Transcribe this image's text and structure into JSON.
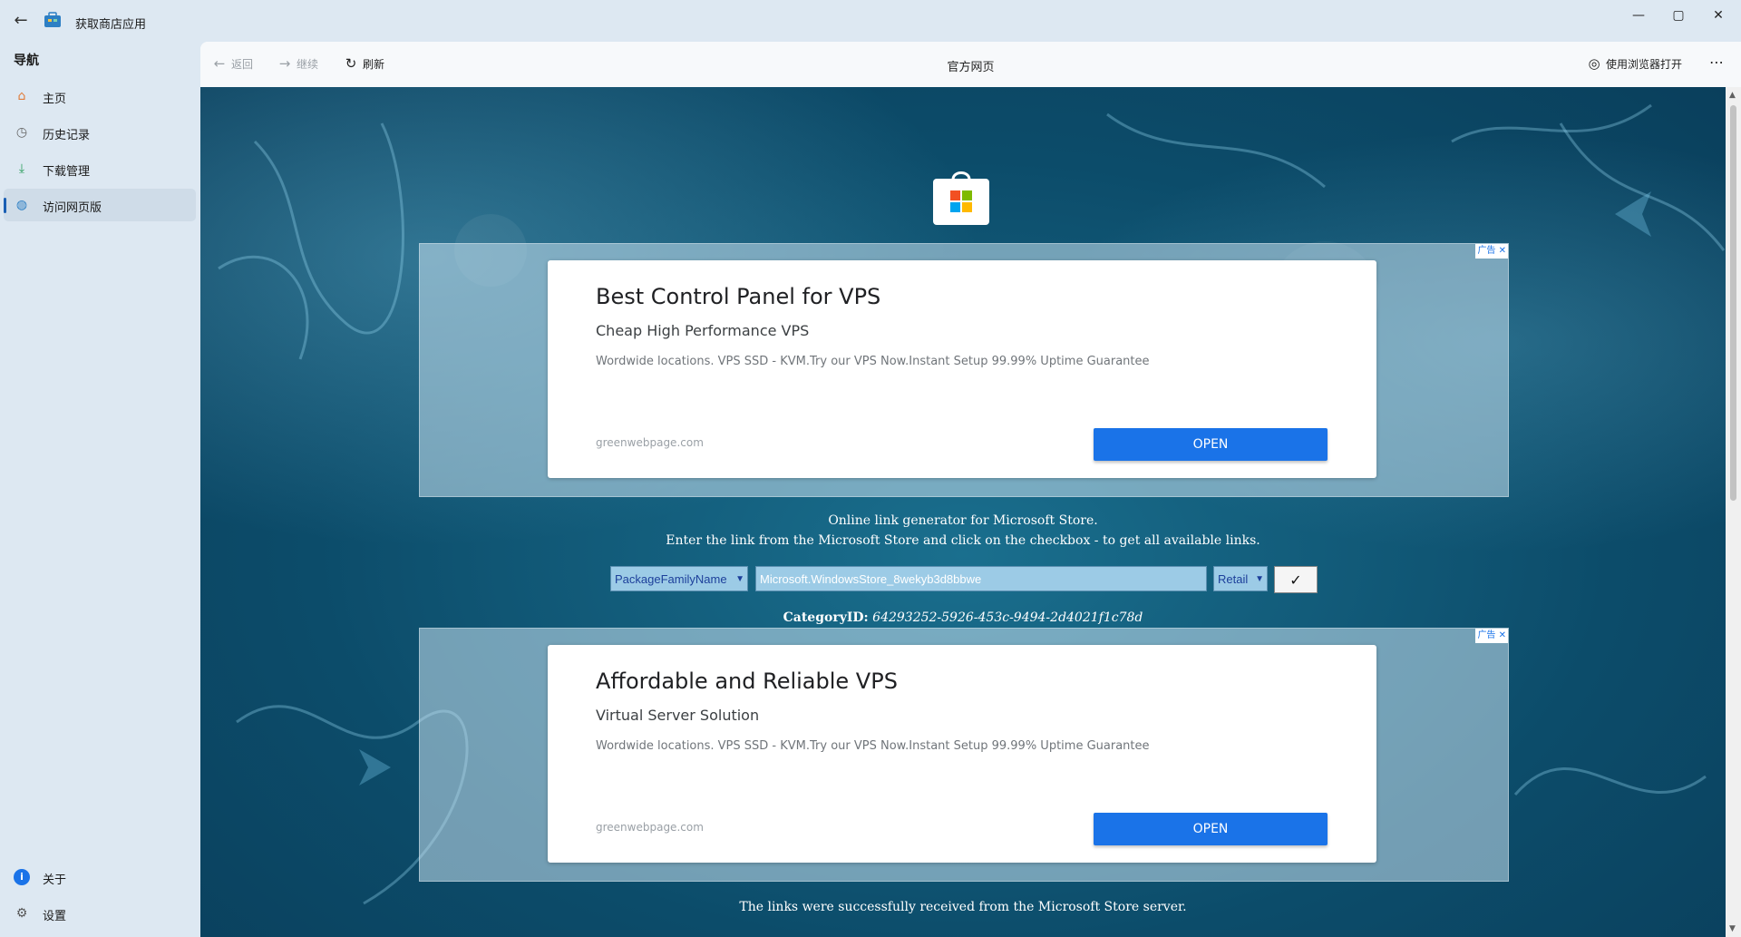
{
  "window": {
    "title": "获取商店应用",
    "controls": {
      "minimize": "—",
      "maximize": "▢",
      "close": "✕"
    }
  },
  "sidebar": {
    "header": "导航",
    "items": [
      {
        "label": "主页",
        "icon": "home-icon"
      },
      {
        "label": "历史记录",
        "icon": "history-icon"
      },
      {
        "label": "下载管理",
        "icon": "download-icon"
      },
      {
        "label": "访问网页版",
        "icon": "globe-icon",
        "active": true
      }
    ],
    "footer_items": [
      {
        "label": "关于",
        "icon": "info-icon"
      },
      {
        "label": "设置",
        "icon": "settings-icon"
      }
    ]
  },
  "toolbar": {
    "back_label": "返回",
    "forward_label": "继续",
    "refresh_label": "刷新",
    "page_title": "官方网页",
    "open_browser_label": "使用浏览器打开",
    "more_label": "⋯"
  },
  "ads": [
    {
      "badge": "广告",
      "headline": "Best Control Panel for VPS",
      "subheadline": "Cheap High Performance VPS",
      "description": "Wordwide locations. VPS SSD - KVM.Try our VPS Now.Instant Setup 99.99% Uptime Guarantee",
      "domain": "greenwebpage.com",
      "button": "OPEN"
    },
    {
      "badge": "广告",
      "headline": "Affordable and Reliable VPS",
      "subheadline": "Virtual Server Solution",
      "description": "Wordwide locations. VPS SSD - KVM.Try our VPS Now.Instant Setup 99.99% Uptime Guarantee",
      "domain": "greenwebpage.com",
      "button": "OPEN"
    }
  ],
  "generator": {
    "line1": "Online link generator for Microsoft Store.",
    "line2": "Enter the link from the Microsoft Store and click on the checkbox - to get all available links.",
    "type_select": "PackageFamilyName",
    "input_value": "Microsoft.WindowsStore_8wekyb3d8bbwe",
    "ring_select": "Retail",
    "submit": "✓",
    "category_label": "CategoryID:",
    "category_value": "64293252-5926-453c-9494-2d4021f1c78d",
    "status": "The links were successfully received from the Microsoft Store server."
  },
  "colors": {
    "accent": "#1a73e8",
    "sidebar_bg": "#dde8f2",
    "webview_bg": "#0c4c6a"
  }
}
